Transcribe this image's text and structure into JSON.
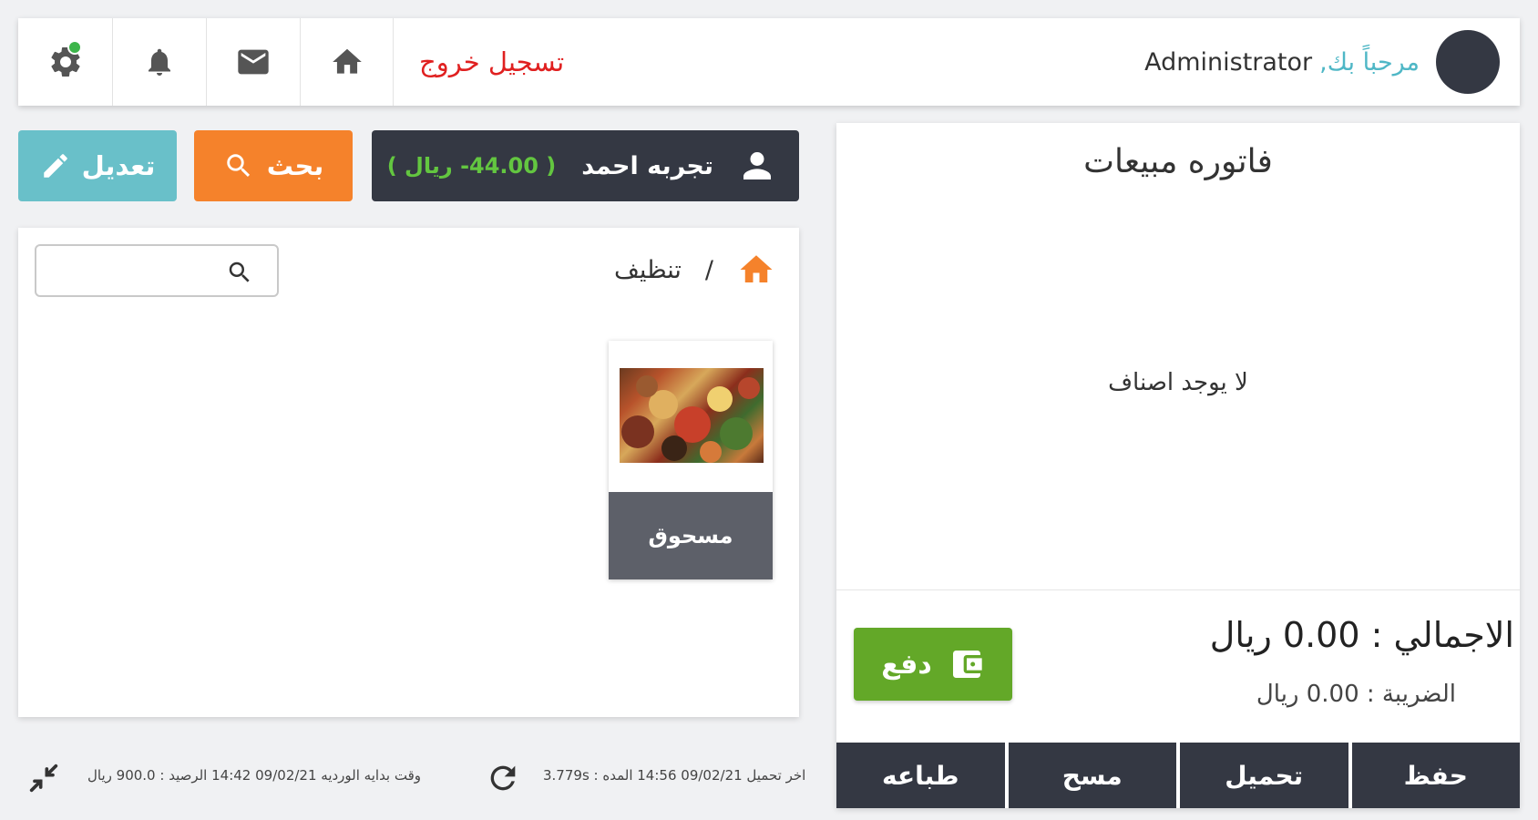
{
  "header": {
    "welcome_greeting": "مرحباً بك,",
    "username": "Administrator",
    "logout_label": "تسجيل خروج"
  },
  "customer": {
    "name": "تجربه احمد",
    "balance": "( 44.00- ريال )"
  },
  "toolbar": {
    "search_label": "بحث",
    "edit_label": "تعديل"
  },
  "breadcrumb": {
    "separator": "/",
    "current": "تنظيف"
  },
  "search": {
    "value": "",
    "placeholder": ""
  },
  "products": [
    {
      "name": "مسحوق"
    }
  ],
  "invoice": {
    "title": "فاتوره مبيعات",
    "empty_message": "لا يوجد اصناف",
    "total_line": "الاجمالي : 0.00 ريال",
    "tax_line": "الضريبة : 0.00 ريال",
    "pay_label": "دفع",
    "actions": {
      "save": "حفظ",
      "load": "تحميل",
      "clear": "مسح",
      "print": "طباعه"
    }
  },
  "status": {
    "session_info": "وقت بدايه الورديه  09/02/21 14:42   الرصيد : 900.0 ريال",
    "load_info": "اخر تحميل  09/02/21 14:56   المده : 3.779s"
  },
  "colors": {
    "dark": "#343843",
    "orange": "#f5822b",
    "teal": "#69c0c9",
    "green": "#63a828",
    "logout_red": "#e02020",
    "notification_dot": "#3cb54a"
  },
  "icons": {
    "settings": "gear-icon",
    "notifications": "bell-icon",
    "messages": "mail-icon",
    "home": "home-icon",
    "customer": "user-icon",
    "search": "search-icon",
    "edit": "pencil-icon",
    "pay": "wallet-icon",
    "refresh": "refresh-icon",
    "fullscreen": "compress-icon"
  }
}
